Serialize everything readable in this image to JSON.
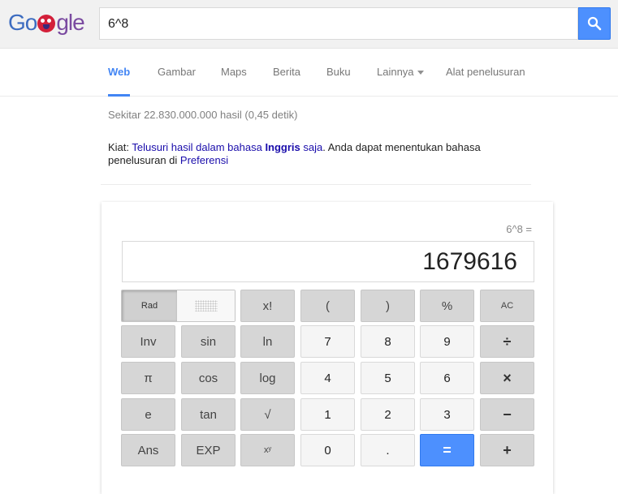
{
  "logo": {
    "alt": "Google"
  },
  "search": {
    "query": "6^8"
  },
  "nav": {
    "tabs": [
      {
        "label": "Web",
        "active": true
      },
      {
        "label": "Gambar"
      },
      {
        "label": "Maps"
      },
      {
        "label": "Berita"
      },
      {
        "label": "Buku"
      },
      {
        "label": "Lainnya"
      },
      {
        "label": "Alat penelusuran"
      }
    ]
  },
  "results": {
    "stats": "Sekitar 22.830.000.000 hasil (0,45 detik)",
    "tip": {
      "prefix": "Kiat: ",
      "link1": "Telusuri hasil dalam bahasa ",
      "lang": "Inggris",
      "link1_end": " saja",
      "middle": ". Anda dapat menentukan bahasa penelusuran di ",
      "link2": "Preferensi"
    }
  },
  "calculator": {
    "expression": "6^8 =",
    "result": "1679616",
    "rad_label": "Rad",
    "rows": [
      [
        "x!",
        "(",
        ")",
        "%",
        "AC"
      ],
      [
        "Inv",
        "sin",
        "ln",
        "7",
        "8",
        "9",
        "÷"
      ],
      [
        "π",
        "cos",
        "log",
        "4",
        "5",
        "6",
        "×"
      ],
      [
        "e",
        "tan",
        "√",
        "1",
        "2",
        "3",
        "−"
      ],
      [
        "Ans",
        "EXP",
        "xʸ",
        "0",
        ".",
        "=",
        "+"
      ]
    ]
  },
  "colors": {
    "accent": "#4285f4",
    "link": "#1a0dab",
    "equals": "#4d90fe"
  }
}
